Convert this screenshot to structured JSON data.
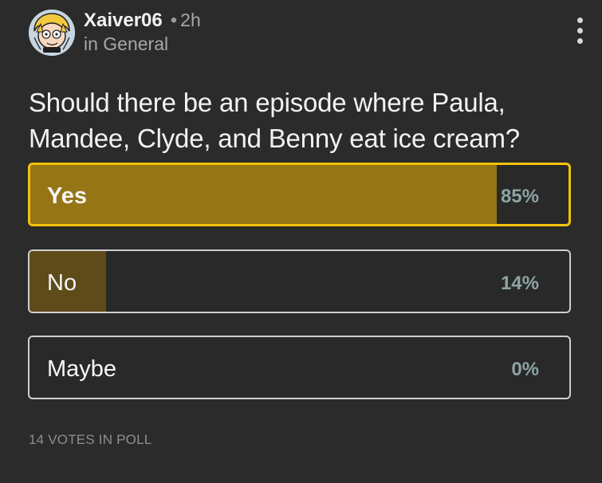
{
  "post": {
    "author": "Xaiver06",
    "separator": "•",
    "time": "2h",
    "community": "in General",
    "question": "Should there be an episode where Paula, Mandee, Clyde, and Benny eat ice cream?",
    "avatar_icon": "cartoon-avatar-icon",
    "menu_icon": "vertical-ellipsis-icon"
  },
  "poll": {
    "options": [
      {
        "label": "Yes",
        "percent_text": "85%",
        "percent": 85,
        "selected": true,
        "fill_color": "#957515"
      },
      {
        "label": "No",
        "percent_text": "14%",
        "percent": 14,
        "selected": false,
        "fill_color": "#5f4b1a"
      },
      {
        "label": "Maybe",
        "percent_text": "0%",
        "percent": 0,
        "selected": false,
        "fill_color": "#5f4b1a"
      }
    ],
    "total_votes_text": "14 VOTES IN POLL"
  },
  "colors": {
    "background": "#2b2b2b",
    "selected_border": "#f4c20d",
    "percent_text": "#8da3a3"
  }
}
